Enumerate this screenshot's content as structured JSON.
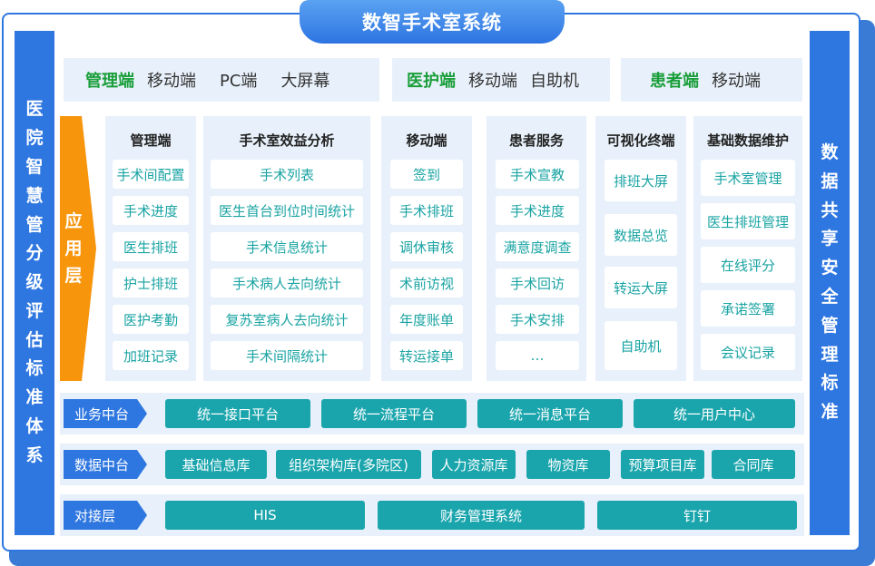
{
  "title": "数智手术室系统",
  "left_side": [
    "医",
    "院",
    "智",
    "慧",
    "管",
    "分",
    "级",
    "评",
    "估",
    "标",
    "准",
    "体",
    "系"
  ],
  "right_side": [
    "数",
    "据",
    "共",
    "享",
    "安",
    "全",
    "管",
    "理",
    "标",
    "准"
  ],
  "top": {
    "g1": {
      "hl": "管理端",
      "items": [
        "移动端",
        "PC端",
        "大屏幕"
      ]
    },
    "g2": {
      "hl": "医护端",
      "items": [
        "移动端",
        "自助机"
      ]
    },
    "g3": {
      "hl": "患者端",
      "items": [
        "移动端"
      ]
    }
  },
  "app_layer": [
    "应",
    "用",
    "层"
  ],
  "columns": [
    {
      "title": "管理端",
      "items": [
        "手术间配置",
        "手术进度",
        "医生排班",
        "护士排班",
        "医护考勤",
        "加班记录"
      ]
    },
    {
      "title": "手术室效益分析",
      "items": [
        "手术列表",
        "医生首台到位时间统计",
        "手术信息统计",
        "手术病人去向统计",
        "复苏室病人去向统计",
        "手术间隔统计"
      ]
    },
    {
      "title": "移动端",
      "items": [
        "签到",
        "手术排班",
        "调休审核",
        "术前访视",
        "年度账单",
        "转运接单"
      ]
    },
    {
      "title": "患者服务",
      "items": [
        "手术宣教",
        "手术进度",
        "满意度调查",
        "手术回访",
        "手术安排",
        "…"
      ]
    },
    {
      "title": "可视化终端",
      "items": [
        "排班大屏",
        "数据总览",
        "转运大屏",
        "自助机"
      ]
    },
    {
      "title": "基础数据维护",
      "items": [
        "手术室管理",
        "医生排班管理",
        "在线评分",
        "承诺签署",
        "会议记录"
      ]
    }
  ],
  "bands": [
    {
      "label": "业务中台",
      "items": [
        "统一接口平台",
        "统一流程平台",
        "统一消息平台",
        "统一用户中心"
      ]
    },
    {
      "label": "数据中台",
      "items": [
        "基础信息库",
        "组织架构库(多院区)",
        "人力资源库",
        "物资库",
        "预算项目库",
        "合同库"
      ]
    },
    {
      "label": "对接层",
      "items": [
        "HIS",
        "财务管理系统",
        "钉钉"
      ]
    }
  ],
  "colors": {
    "primary": "#2f77e0",
    "teal": "#1aa5ad",
    "orange": "#f7950d",
    "green": "#1a9e3a",
    "panel": "#e8f1fb"
  }
}
